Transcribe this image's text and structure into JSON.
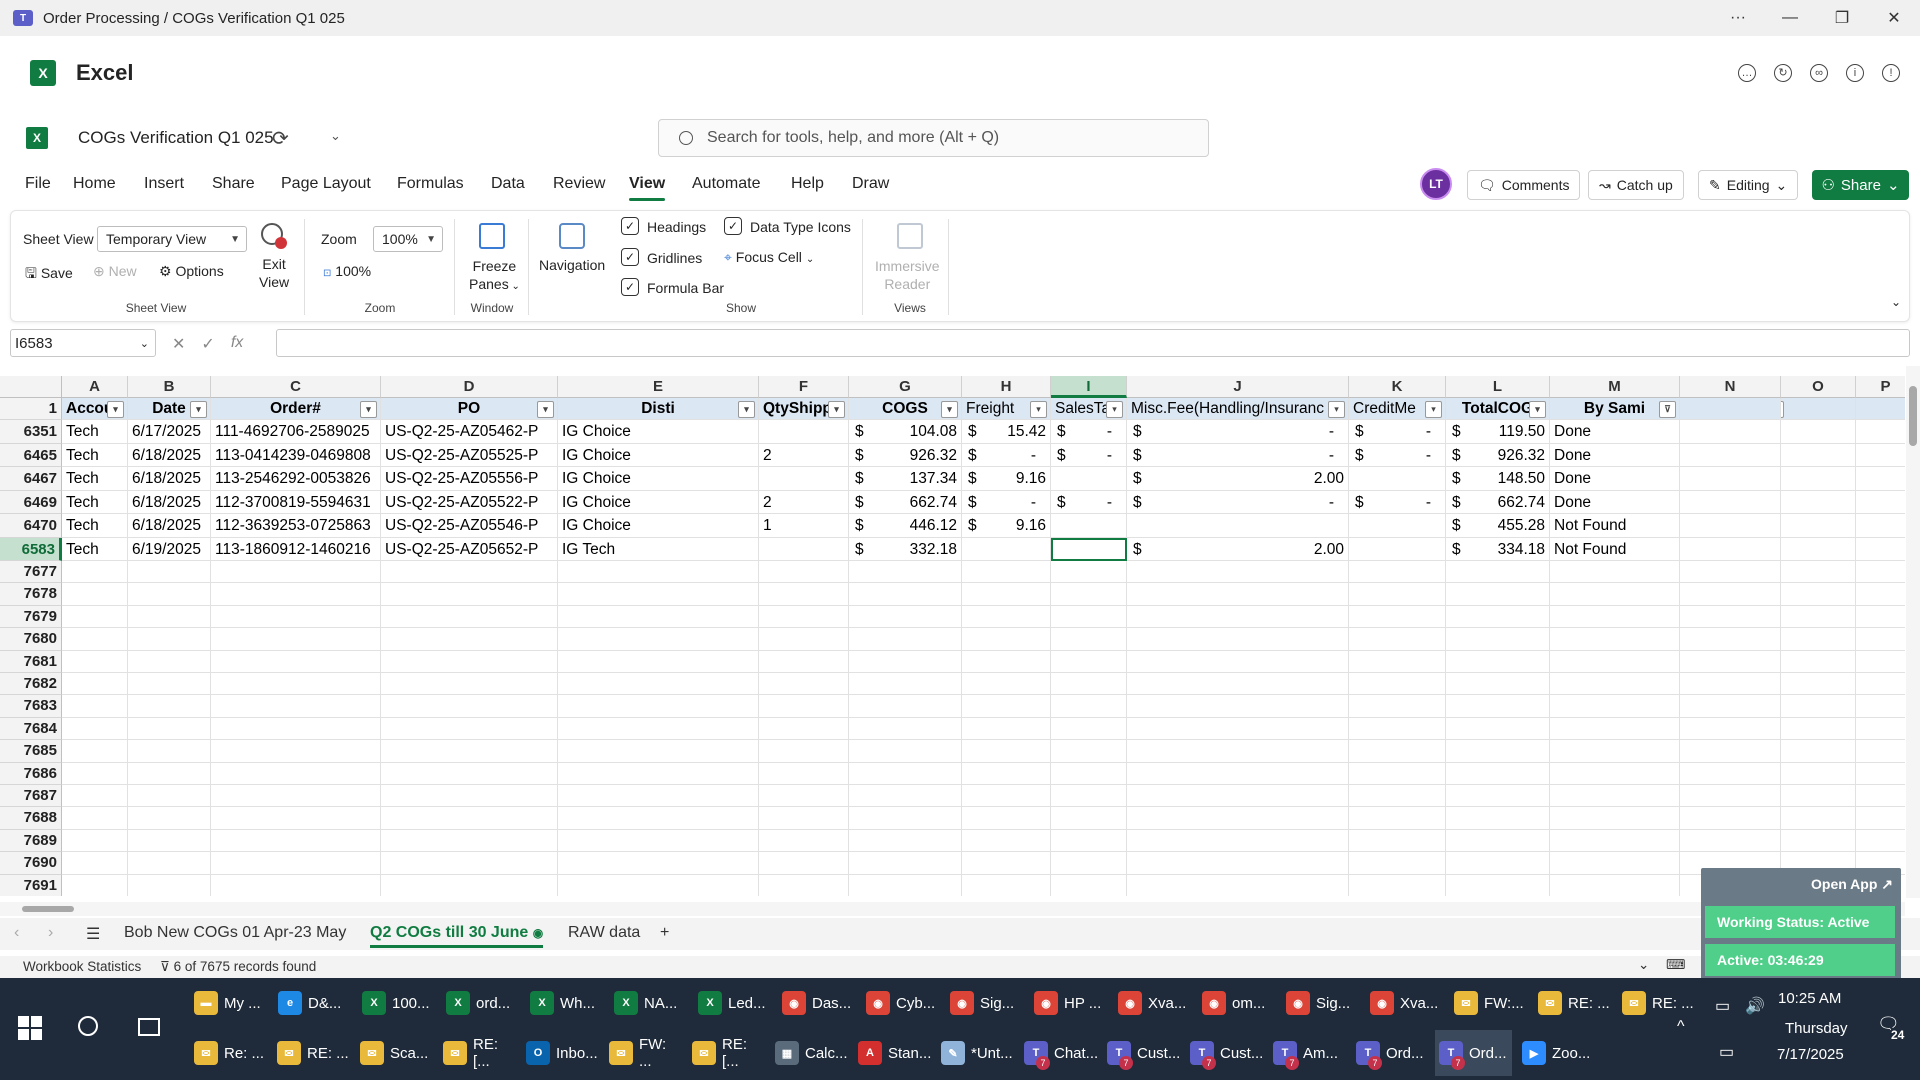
{
  "window": {
    "title": "Order Processing / COGs Verification Q1 025",
    "more_label": "···",
    "minimize_label": "—",
    "restore_label": "❐",
    "close_label": "✕"
  },
  "app": {
    "name": "Excel",
    "logo_letter": "X"
  },
  "file": {
    "name": "COGs Verification Q1 025"
  },
  "search": {
    "placeholder": "Search for tools, help, and more (Alt + Q)"
  },
  "menu": {
    "tabs": [
      "File",
      "Home",
      "Insert",
      "Share",
      "Page Layout",
      "Formulas",
      "Data",
      "Review",
      "View",
      "Automate",
      "Help",
      "Draw"
    ],
    "active": "View",
    "avatar_initials": "LT",
    "comments_label": "Comments",
    "catchup_label": "Catch up",
    "editing_label": "Editing",
    "share_label": "Share"
  },
  "ribbon": {
    "sheet_view_label": "Sheet View",
    "sheet_view_value": "Temporary View",
    "save_label": "Save",
    "new_label": "New",
    "options_label": "Options",
    "exit_view_line1": "Exit",
    "exit_view_line2": "View",
    "group_sheet_view": "Sheet View",
    "zoom_label": "Zoom",
    "zoom_value": "100%",
    "zoom100_label": "100%",
    "group_zoom": "Zoom",
    "freeze_line1": "Freeze",
    "freeze_line2": "Panes",
    "group_window": "Window",
    "navigation_label": "Navigation",
    "headings_label": "Headings",
    "gridlines_label": "Gridlines",
    "formula_bar_label": "Formula Bar",
    "data_type_icons_label": "Data Type Icons",
    "focus_cell_label": "Focus Cell",
    "group_show": "Show",
    "immersive_line1": "Immersive",
    "immersive_line2": "Reader",
    "group_views": "Views"
  },
  "formula_bar": {
    "name_box": "I6583",
    "fx_label": "fx",
    "content": ""
  },
  "grid": {
    "columns": [
      "A",
      "B",
      "C",
      "D",
      "E",
      "F",
      "G",
      "H",
      "I",
      "J",
      "K",
      "L",
      "M",
      "N",
      "O",
      "P"
    ],
    "selected_column": "I",
    "header_row_number": "1",
    "headers": [
      "Accou",
      "Date",
      "Order#",
      "PO",
      "Disti",
      "QtyShipp",
      "COGS",
      "Freight",
      "SalesTa",
      "Misc.Fee(Handling/Insuranc",
      "CreditMe",
      "TotalCOG",
      "By Sami",
      "",
      "",
      ""
    ],
    "rows": [
      {
        "n": "6351",
        "A": "Tech",
        "B": "6/17/2025",
        "C": "111-4692706-2589025",
        "D": "US-Q2-25-AZ05462-P",
        "E": "IG Choice",
        "F": "",
        "G": "104.08",
        "H": "15.42",
        "I": "-",
        "J": "-",
        "K": "-",
        "L": "119.50",
        "M": "Done"
      },
      {
        "n": "6465",
        "A": "Tech",
        "B": "6/18/2025",
        "C": "113-0414239-0469808",
        "D": "US-Q2-25-AZ05525-P",
        "E": "IG Choice",
        "F": "2",
        "G": "926.32",
        "H": "-",
        "I": "-",
        "J": "-",
        "K": "-",
        "L": "926.32",
        "M": "Done"
      },
      {
        "n": "6467",
        "A": "Tech",
        "B": "6/18/2025",
        "C": "113-2546292-0053826",
        "D": "US-Q2-25-AZ05556-P",
        "E": "IG Choice",
        "F": "",
        "G": "137.34",
        "H": "9.16",
        "I": "",
        "J": "2.00",
        "K": "",
        "L": "148.50",
        "M": "Done"
      },
      {
        "n": "6469",
        "A": "Tech",
        "B": "6/18/2025",
        "C": "112-3700819-5594631",
        "D": "US-Q2-25-AZ05522-P",
        "E": "IG Choice",
        "F": "2",
        "G": "662.74",
        "H": "-",
        "I": "-",
        "J": "-",
        "K": "-",
        "L": "662.74",
        "M": "Done"
      },
      {
        "n": "6470",
        "A": "Tech",
        "B": "6/18/2025",
        "C": "112-3639253-0725863",
        "D": "US-Q2-25-AZ05546-P",
        "E": "IG Choice",
        "F": "1",
        "G": "446.12",
        "H": "9.16",
        "I": "",
        "J": "",
        "K": "",
        "L": "455.28",
        "M": "Not Found"
      },
      {
        "n": "6583",
        "A": "Tech",
        "B": "6/19/2025",
        "C": "113-1860912-1460216",
        "D": "US-Q2-25-AZ05652-P",
        "E": "IG Tech",
        "F": "",
        "G": "332.18",
        "H": "",
        "I": "",
        "J": "2.00",
        "K": "",
        "L": "334.18",
        "M": "Not Found"
      }
    ],
    "empty_rows": [
      "7677",
      "7678",
      "7679",
      "7680",
      "7681",
      "7682",
      "7683",
      "7684",
      "7685",
      "7686",
      "7687",
      "7688",
      "7689",
      "7690",
      "7691"
    ],
    "currency_symbol": "$",
    "selected_row": "6583"
  },
  "sheets": {
    "tabs": [
      "Bob New COGs 01 Apr-23 May",
      "Q2 COGs till 30 June",
      "RAW data"
    ],
    "active": "Q2 COGs till 30 June",
    "add_label": "+"
  },
  "status": {
    "workbook_stats": "Workbook Statistics",
    "filter_text": "6 of 7675 records found"
  },
  "widget": {
    "open_app": "Open App ↗",
    "working_status": "Working Status: Active",
    "active_time": "Active: 03:46:29"
  },
  "taskbar": {
    "row1": [
      {
        "label": "My ...",
        "icon": "folder",
        "color": "#e8b93b"
      },
      {
        "label": "D&...",
        "icon": "edge",
        "color": "#1e88e5"
      },
      {
        "label": "100...",
        "icon": "X",
        "color": "#107c41"
      },
      {
        "label": "ord...",
        "icon": "X",
        "color": "#107c41"
      },
      {
        "label": "Wh...",
        "icon": "X",
        "color": "#107c41"
      },
      {
        "label": "NA...",
        "icon": "X",
        "color": "#107c41"
      },
      {
        "label": "Led...",
        "icon": "X",
        "color": "#107c41"
      },
      {
        "label": "Das...",
        "icon": "chrome",
        "color": "#db4437"
      },
      {
        "label": "Cyb...",
        "icon": "chrome",
        "color": "#db4437"
      },
      {
        "label": "Sig...",
        "icon": "chrome",
        "color": "#db4437"
      },
      {
        "label": "HP ...",
        "icon": "chrome",
        "color": "#db4437"
      },
      {
        "label": "Xva...",
        "icon": "chrome",
        "color": "#db4437"
      },
      {
        "label": "om...",
        "icon": "chrome",
        "color": "#db4437"
      },
      {
        "label": "Sig...",
        "icon": "chrome",
        "color": "#db4437"
      },
      {
        "label": "Xva...",
        "icon": "chrome",
        "color": "#db4437"
      },
      {
        "label": "FW:...",
        "icon": "mail",
        "color": "#e8b93b"
      },
      {
        "label": "RE: ...",
        "icon": "mail",
        "color": "#e8b93b"
      },
      {
        "label": "RE: ...",
        "icon": "mail",
        "color": "#e8b93b"
      }
    ],
    "row2": [
      {
        "label": "Re: ...",
        "icon": "mail",
        "color": "#e8b93b"
      },
      {
        "label": "RE: ...",
        "icon": "mail",
        "color": "#e8b93b"
      },
      {
        "label": "Sca...",
        "icon": "mail",
        "color": "#e8b93b"
      },
      {
        "label": "RE: [...",
        "icon": "mail",
        "color": "#e8b93b"
      },
      {
        "label": "Inbo...",
        "icon": "O",
        "color": "#0a64ad"
      },
      {
        "label": "FW: ...",
        "icon": "mail",
        "color": "#e8b93b"
      },
      {
        "label": "RE: [...",
        "icon": "mail",
        "color": "#e8b93b"
      },
      {
        "label": "Calc...",
        "icon": "calc",
        "color": "#5a6b7c"
      },
      {
        "label": "Stan...",
        "icon": "pdf",
        "color": "#d32f2f"
      },
      {
        "label": "*Unt...",
        "icon": "note",
        "color": "#8fb3d9"
      },
      {
        "label": "Chat...",
        "icon": "T",
        "color": "#5b5fc7"
      },
      {
        "label": "Cust...",
        "icon": "T",
        "color": "#5b5fc7"
      },
      {
        "label": "Cust...",
        "icon": "T",
        "color": "#5b5fc7"
      },
      {
        "label": "Am...",
        "icon": "T",
        "color": "#5b5fc7"
      },
      {
        "label": "Ord...",
        "icon": "T",
        "color": "#5b5fc7"
      },
      {
        "label": "Ord...",
        "icon": "T",
        "color": "#5b5fc7"
      },
      {
        "label": "Zoo...",
        "icon": "zoom",
        "color": "#2d8cff"
      }
    ],
    "time": "10:25 AM",
    "day": "Thursday",
    "date": "7/17/2025",
    "notif_count": "24",
    "teams_badge": "7"
  }
}
